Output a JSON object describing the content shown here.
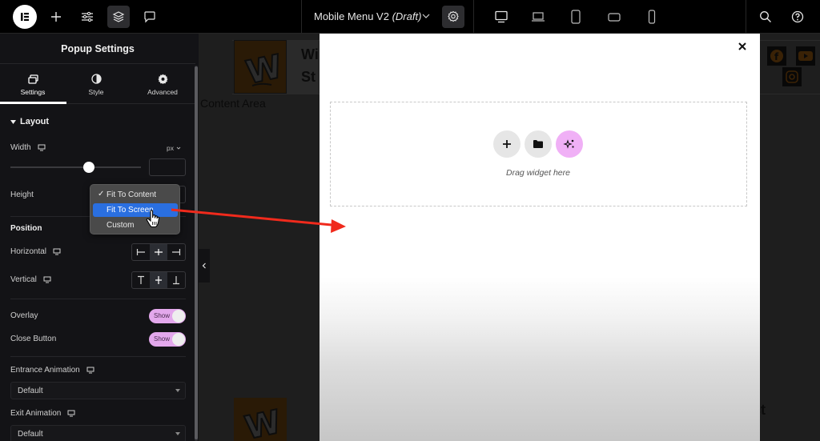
{
  "topbar": {
    "document_title": "Mobile Menu V2",
    "document_status": "(Draft)",
    "icons": [
      "elementor-logo-icon",
      "add-icon",
      "sliders-icon",
      "layers-icon",
      "comment-icon",
      "settings-gear-icon",
      "desktop-icon",
      "laptop-icon",
      "tablet-portrait-icon",
      "tablet-landscape-icon",
      "mobile-icon",
      "search-icon",
      "help-icon"
    ]
  },
  "panel": {
    "title": "Popup Settings",
    "tabs": [
      {
        "label": "Settings",
        "icon": "settings-window-icon",
        "active": true
      },
      {
        "label": "Style",
        "icon": "half-circle-icon",
        "active": false
      },
      {
        "label": "Advanced",
        "icon": "gear-icon",
        "active": false
      }
    ],
    "layout": {
      "heading": "Layout",
      "width_label": "Width",
      "width_unit": "px",
      "width_value": "",
      "width_slider_fraction": 0.6,
      "height_label": "Height"
    },
    "height_menu": {
      "options": [
        "Fit To Content",
        "Fit To Screen",
        "Custom"
      ],
      "checked": "Fit To Content",
      "highlighted": "Fit To Screen"
    },
    "position": {
      "heading": "Position",
      "horizontal_label": "Horizontal",
      "vertical_label": "Vertical",
      "horizontal_selected": "center",
      "vertical_selected": "center"
    },
    "overlay": {
      "label": "Overlay",
      "toggle": "Show"
    },
    "close_button": {
      "label": "Close Button",
      "toggle": "Show"
    },
    "entrance_animation": {
      "label": "Entrance Animation",
      "value": "Default"
    },
    "exit_animation": {
      "label": "Exit Animation",
      "value": "Default"
    }
  },
  "canvas": {
    "site_title_line1": "Wi",
    "site_title_line2": "St",
    "content_area": "Content Area",
    "footer_text": "ct",
    "logo_letter": "W"
  },
  "popup": {
    "drag_text": "Drag widget here"
  },
  "colors": {
    "accent_pink": "#f0b0f6",
    "highlight_blue": "#2a6fe0",
    "annotation_red": "#f02a1c"
  }
}
